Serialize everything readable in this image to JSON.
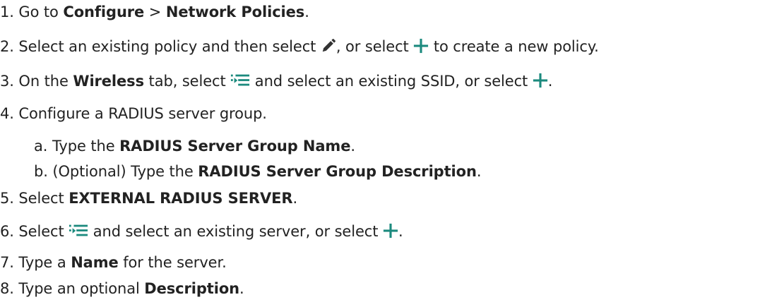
{
  "steps": [
    {
      "num": "1.",
      "parts": [
        "Go to ",
        "Configure",
        " > ",
        "Network Policies",
        "."
      ]
    },
    {
      "num": "2.",
      "parts": [
        "Select an existing policy and then select ",
        ", or select ",
        " to create a new policy."
      ],
      "icons": [
        "edit-icon",
        "add-icon"
      ]
    },
    {
      "num": "3.",
      "parts": [
        "On the ",
        "Wireless",
        " tab, select ",
        " and select an existing SSID, or select ",
        "."
      ],
      "icons": [
        "select-list-icon",
        "add-icon"
      ]
    },
    {
      "num": "4.",
      "parts": [
        "Configure a RADIUS server group."
      ]
    },
    {
      "num": "a.",
      "parts": [
        "Type the ",
        "RADIUS Server Group Name",
        "."
      ]
    },
    {
      "num": "b.",
      "parts": [
        "(Optional) Type the ",
        "RADIUS Server Group Description",
        "."
      ]
    },
    {
      "num": "5.",
      "parts": [
        "Select ",
        "EXTERNAL RADIUS SERVER",
        "."
      ]
    },
    {
      "num": "6.",
      "parts": [
        "Select ",
        " and select an existing server, or select ",
        "."
      ],
      "icons": [
        "select-list-icon",
        "add-icon"
      ]
    },
    {
      "num": "7.",
      "parts": [
        "Type a ",
        "Name",
        " for the server."
      ]
    },
    {
      "num": "8.",
      "parts": [
        "Type an optional ",
        "Description",
        "."
      ]
    }
  ],
  "colors": {
    "text": "#222222",
    "add_icon": "#1c8a7e",
    "list_icon": "#1c8a7e",
    "edit_icon": "#333333"
  }
}
